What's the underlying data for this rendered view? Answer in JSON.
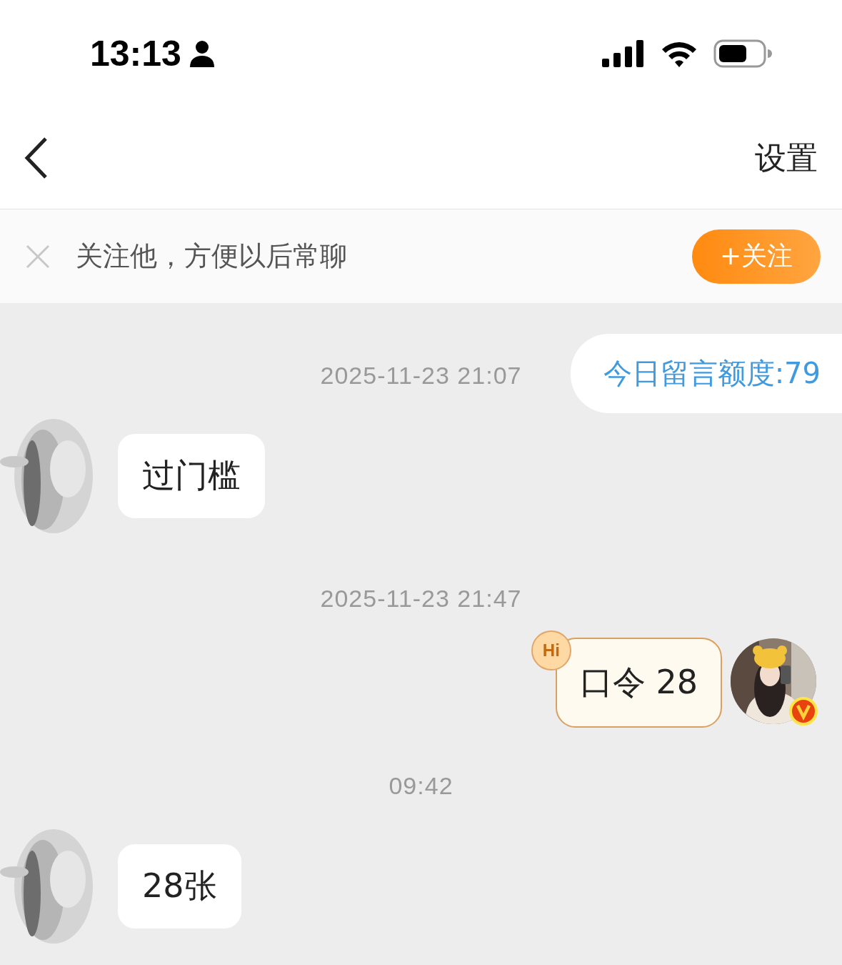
{
  "status_bar": {
    "time": "13:13"
  },
  "nav": {
    "settings": "设置"
  },
  "follow_banner": {
    "text": "关注他，方便以后常聊",
    "button": "+关注"
  },
  "quota": "今日留言额度:79",
  "messages": [
    {
      "kind": "time",
      "text": "2025-11-23 21:07"
    },
    {
      "kind": "incoming",
      "text": "过门槛"
    },
    {
      "kind": "time",
      "text": "2025-11-23 21:47"
    },
    {
      "kind": "outgoing",
      "text": "口令 28",
      "badge": "Hi"
    },
    {
      "kind": "time",
      "text": "09:42"
    },
    {
      "kind": "incoming",
      "text": "28张"
    }
  ]
}
